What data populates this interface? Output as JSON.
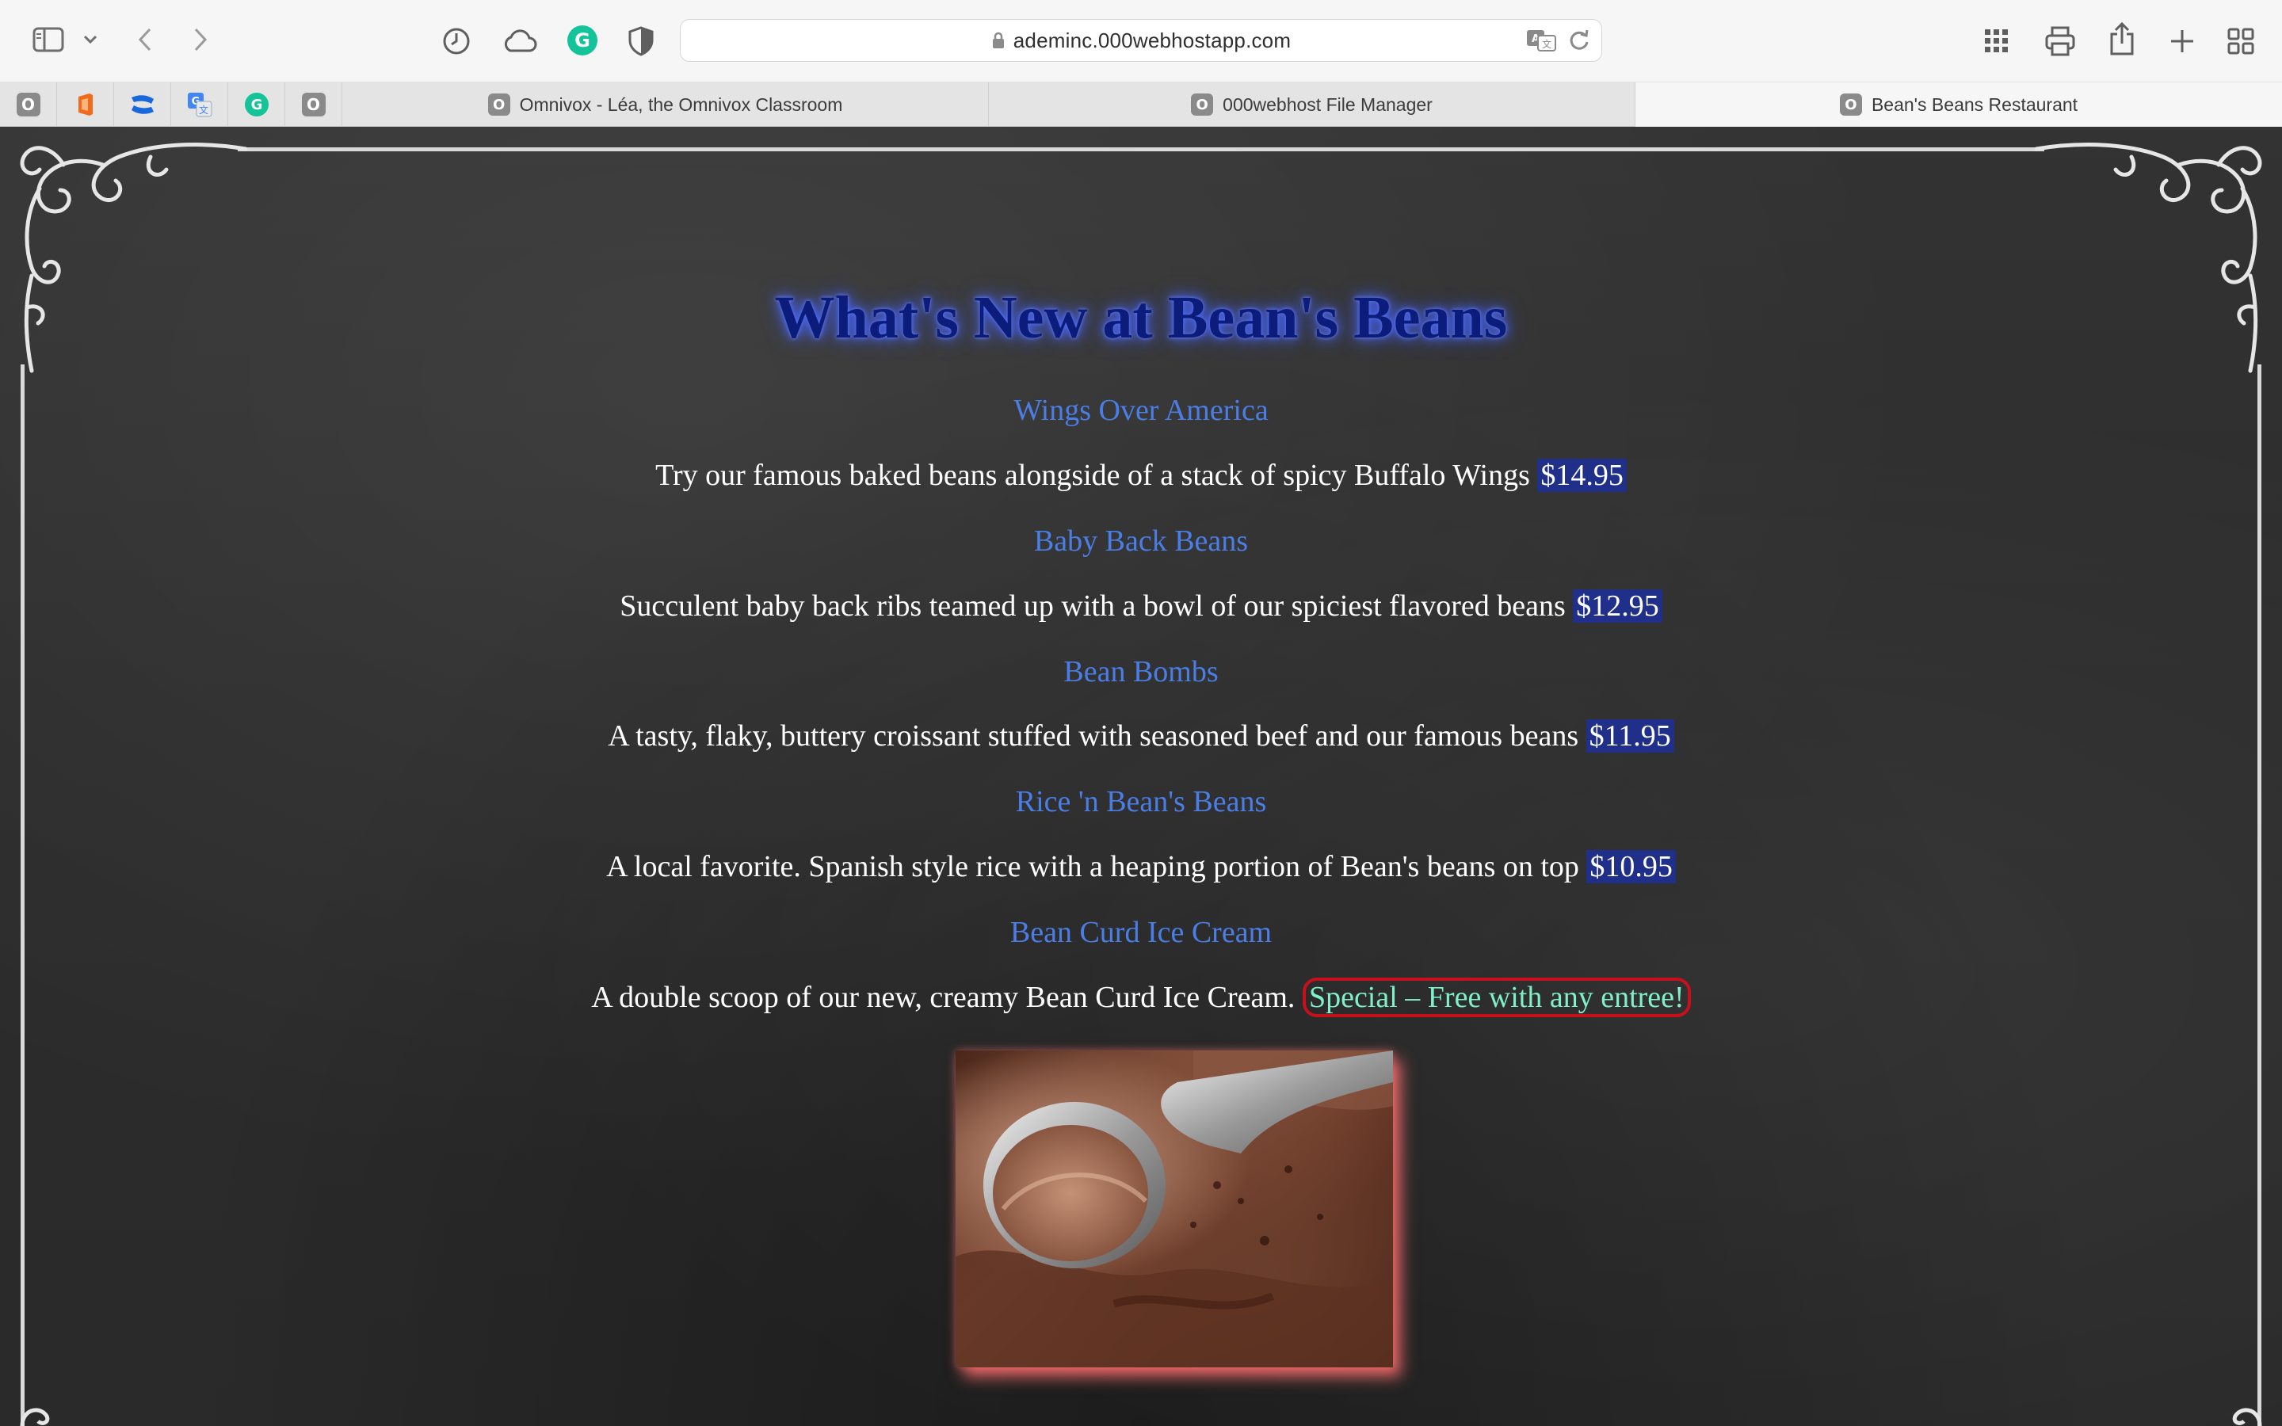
{
  "browser": {
    "url": "ademinc.000webhostapp.com",
    "tabs": [
      {
        "label": "Omnivox - Léa, the Omnivox Classroom",
        "favicon": "O"
      },
      {
        "label": "000webhost File Manager",
        "favicon": "O"
      },
      {
        "label": "Bean's Beans Restaurant",
        "favicon": "O",
        "active": true
      }
    ],
    "pinned_tabs": [
      {
        "icon": "omnivox-favicon",
        "glyph": "O"
      },
      {
        "icon": "office-favicon"
      },
      {
        "icon": "confluence-favicon"
      },
      {
        "icon": "translate-favicon"
      },
      {
        "icon": "grammarly-favicon"
      },
      {
        "icon": "omnivox-favicon",
        "glyph": "O"
      }
    ]
  },
  "page": {
    "headline": "What's New at Bean's Beans",
    "dishes": [
      {
        "name": "Wings Over America",
        "description": "Try our famous baked beans alongside of a stack of spicy Buffalo Wings",
        "price": "$14.95"
      },
      {
        "name": "Baby Back Beans",
        "description": "Succulent baby back ribs teamed up with a bowl of our spiciest flavored beans",
        "price": "$12.95"
      },
      {
        "name": "Bean Bombs",
        "description": "A tasty, flaky, buttery croissant stuffed with seasoned beef and our famous beans",
        "price": "$11.95"
      },
      {
        "name": "Rice 'n Bean's Beans",
        "description": "A local favorite. Spanish style rice with a heaping portion of Bean's beans on top",
        "price": "$10.95"
      },
      {
        "name": "Bean Curd Ice Cream",
        "description": "A double scoop of our new, creamy Bean Curd Ice Cream.",
        "special": "Special – Free with any entree!"
      }
    ],
    "image": {
      "subject": "ice-cream-scoop-photo"
    }
  },
  "colors": {
    "headline": "#0c1c7a",
    "dish_name": "#4a7ee6",
    "price_bg": "#1f2f8a",
    "special_text": "#7ff0c8",
    "special_border": "#c8101c"
  }
}
